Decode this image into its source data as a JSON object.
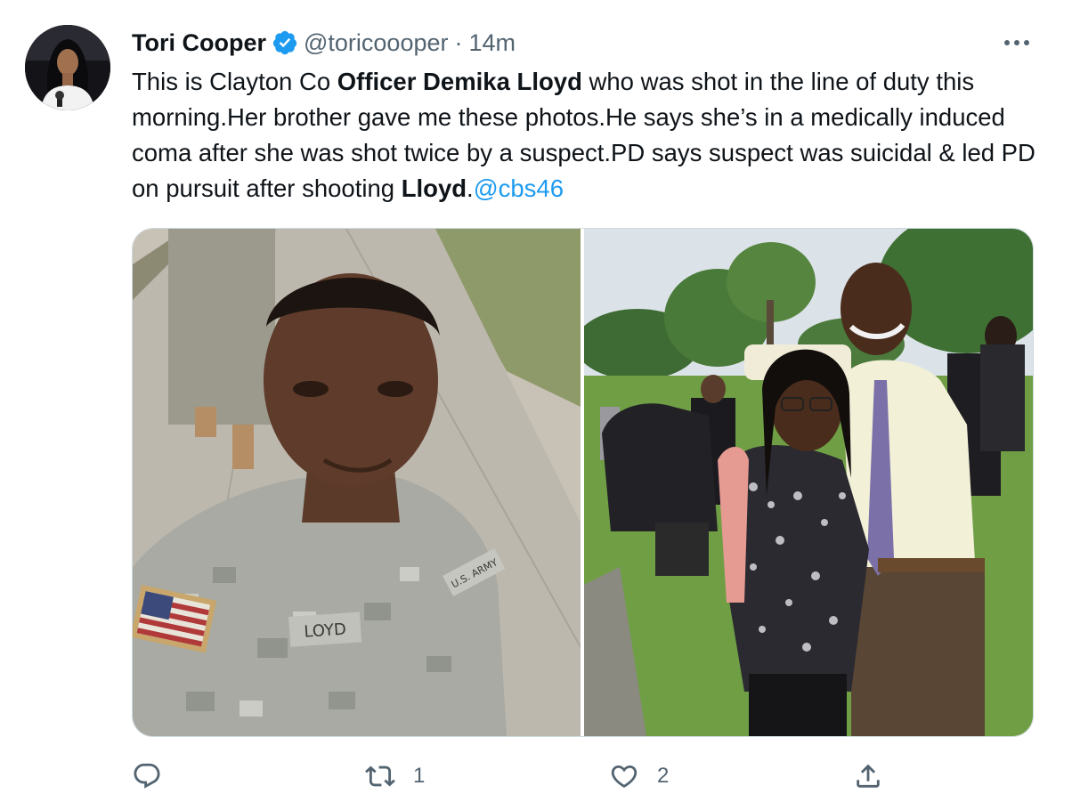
{
  "author": {
    "display_name": "Tori Cooper",
    "handle": "@toricoooper",
    "separator": "·",
    "timestamp": "14m",
    "verified": true,
    "verified_color": "#1d9bf0"
  },
  "tweet": {
    "segments": [
      {
        "text": "This is Clayton Co ",
        "style": "normal"
      },
      {
        "text": "Officer Demika Lloyd",
        "style": "bold"
      },
      {
        "text": " who was shot in the line of duty this morning.Her brother gave me these photos.He says she’s in a medically induced coma after she was shot twice by a suspect.PD says suspect was suicidal & led PD on pursuit after shooting ",
        "style": "normal"
      },
      {
        "text": "Lloyd",
        "style": "bold"
      },
      {
        "text": ".",
        "style": "normal"
      },
      {
        "text": "@cbs46",
        "style": "mention"
      }
    ],
    "mention_color": "#1d9bf0"
  },
  "media": {
    "photo_left": {
      "name_tape": "LOYD",
      "branch_tape": "U.S. ARMY"
    }
  },
  "actions": {
    "reply": {
      "icon": "reply-icon",
      "count": ""
    },
    "retweet": {
      "icon": "retweet-icon",
      "count": "1"
    },
    "like": {
      "icon": "heart-icon",
      "count": "2"
    },
    "share": {
      "icon": "share-icon",
      "count": ""
    }
  },
  "more_icon": "more-dots-icon",
  "colors": {
    "text": "#0f1419",
    "secondary": "#536471",
    "border": "#cfd9de"
  }
}
